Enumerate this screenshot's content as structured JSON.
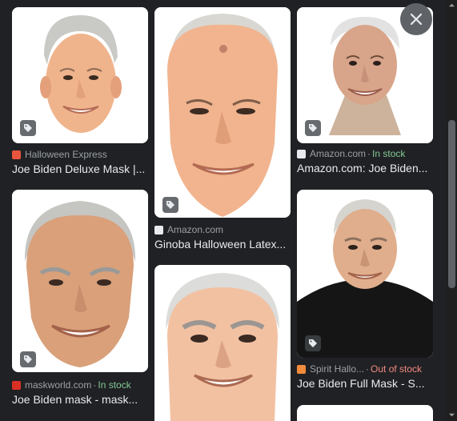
{
  "results": [
    {
      "source": "Halloween Express",
      "stock": "",
      "title": "Joe Biden Deluxe Mask |...",
      "favicon_color": "#e8553e",
      "has_tag": true
    },
    {
      "source": "Amazon.com",
      "stock": "",
      "title": "Ginoba Halloween Latex...",
      "favicon_color": "#e8eaed",
      "has_tag": true
    },
    {
      "source": "Amazon.com",
      "stock": "In stock",
      "stock_state": "in",
      "title": "Amazon.com: Joe Biden...",
      "favicon_color": "#e8eaed",
      "has_tag": true
    },
    {
      "source": "maskworld.com",
      "stock": "In stock",
      "stock_state": "in",
      "title": "Joe Biden mask - mask...",
      "favicon_color": "#d93025",
      "has_tag": true
    },
    {
      "source": "Spirit Hallo...",
      "stock": "Out of stock",
      "stock_state": "out",
      "title": "Joe Biden Full Mask - S...",
      "favicon_color": "#f28b3b",
      "has_tag": true
    }
  ],
  "separator": "·",
  "icons": {
    "close": "close-icon",
    "tag": "price-tag-icon",
    "scroll_up": "scroll-up-arrow-icon",
    "scroll_down": "scroll-down-arrow-icon"
  },
  "colors": {
    "background": "#202124",
    "in_stock": "#81c995",
    "out_of_stock": "#f28b82",
    "source_text": "#9aa0a6",
    "title_text": "#e8eaed"
  }
}
